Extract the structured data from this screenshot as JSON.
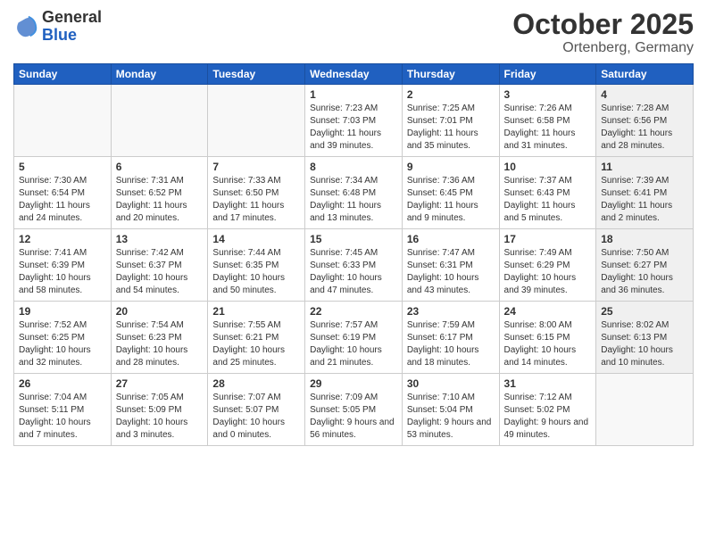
{
  "header": {
    "logo_general": "General",
    "logo_blue": "Blue",
    "month_title": "October 2025",
    "location": "Ortenberg, Germany"
  },
  "weekdays": [
    "Sunday",
    "Monday",
    "Tuesday",
    "Wednesday",
    "Thursday",
    "Friday",
    "Saturday"
  ],
  "weeks": [
    [
      {
        "day": "",
        "info": "",
        "empty": true
      },
      {
        "day": "",
        "info": "",
        "empty": true
      },
      {
        "day": "",
        "info": "",
        "empty": true
      },
      {
        "day": "1",
        "info": "Sunrise: 7:23 AM\nSunset: 7:03 PM\nDaylight: 11 hours and 39 minutes.",
        "shaded": false
      },
      {
        "day": "2",
        "info": "Sunrise: 7:25 AM\nSunset: 7:01 PM\nDaylight: 11 hours and 35 minutes.",
        "shaded": false
      },
      {
        "day": "3",
        "info": "Sunrise: 7:26 AM\nSunset: 6:58 PM\nDaylight: 11 hours and 31 minutes.",
        "shaded": false
      },
      {
        "day": "4",
        "info": "Sunrise: 7:28 AM\nSunset: 6:56 PM\nDaylight: 11 hours and 28 minutes.",
        "shaded": true
      }
    ],
    [
      {
        "day": "5",
        "info": "Sunrise: 7:30 AM\nSunset: 6:54 PM\nDaylight: 11 hours and 24 minutes.",
        "shaded": false
      },
      {
        "day": "6",
        "info": "Sunrise: 7:31 AM\nSunset: 6:52 PM\nDaylight: 11 hours and 20 minutes.",
        "shaded": false
      },
      {
        "day": "7",
        "info": "Sunrise: 7:33 AM\nSunset: 6:50 PM\nDaylight: 11 hours and 17 minutes.",
        "shaded": false
      },
      {
        "day": "8",
        "info": "Sunrise: 7:34 AM\nSunset: 6:48 PM\nDaylight: 11 hours and 13 minutes.",
        "shaded": false
      },
      {
        "day": "9",
        "info": "Sunrise: 7:36 AM\nSunset: 6:45 PM\nDaylight: 11 hours and 9 minutes.",
        "shaded": false
      },
      {
        "day": "10",
        "info": "Sunrise: 7:37 AM\nSunset: 6:43 PM\nDaylight: 11 hours and 5 minutes.",
        "shaded": false
      },
      {
        "day": "11",
        "info": "Sunrise: 7:39 AM\nSunset: 6:41 PM\nDaylight: 11 hours and 2 minutes.",
        "shaded": true
      }
    ],
    [
      {
        "day": "12",
        "info": "Sunrise: 7:41 AM\nSunset: 6:39 PM\nDaylight: 10 hours and 58 minutes.",
        "shaded": false
      },
      {
        "day": "13",
        "info": "Sunrise: 7:42 AM\nSunset: 6:37 PM\nDaylight: 10 hours and 54 minutes.",
        "shaded": false
      },
      {
        "day": "14",
        "info": "Sunrise: 7:44 AM\nSunset: 6:35 PM\nDaylight: 10 hours and 50 minutes.",
        "shaded": false
      },
      {
        "day": "15",
        "info": "Sunrise: 7:45 AM\nSunset: 6:33 PM\nDaylight: 10 hours and 47 minutes.",
        "shaded": false
      },
      {
        "day": "16",
        "info": "Sunrise: 7:47 AM\nSunset: 6:31 PM\nDaylight: 10 hours and 43 minutes.",
        "shaded": false
      },
      {
        "day": "17",
        "info": "Sunrise: 7:49 AM\nSunset: 6:29 PM\nDaylight: 10 hours and 39 minutes.",
        "shaded": false
      },
      {
        "day": "18",
        "info": "Sunrise: 7:50 AM\nSunset: 6:27 PM\nDaylight: 10 hours and 36 minutes.",
        "shaded": true
      }
    ],
    [
      {
        "day": "19",
        "info": "Sunrise: 7:52 AM\nSunset: 6:25 PM\nDaylight: 10 hours and 32 minutes.",
        "shaded": false
      },
      {
        "day": "20",
        "info": "Sunrise: 7:54 AM\nSunset: 6:23 PM\nDaylight: 10 hours and 28 minutes.",
        "shaded": false
      },
      {
        "day": "21",
        "info": "Sunrise: 7:55 AM\nSunset: 6:21 PM\nDaylight: 10 hours and 25 minutes.",
        "shaded": false
      },
      {
        "day": "22",
        "info": "Sunrise: 7:57 AM\nSunset: 6:19 PM\nDaylight: 10 hours and 21 minutes.",
        "shaded": false
      },
      {
        "day": "23",
        "info": "Sunrise: 7:59 AM\nSunset: 6:17 PM\nDaylight: 10 hours and 18 minutes.",
        "shaded": false
      },
      {
        "day": "24",
        "info": "Sunrise: 8:00 AM\nSunset: 6:15 PM\nDaylight: 10 hours and 14 minutes.",
        "shaded": false
      },
      {
        "day": "25",
        "info": "Sunrise: 8:02 AM\nSunset: 6:13 PM\nDaylight: 10 hours and 10 minutes.",
        "shaded": true
      }
    ],
    [
      {
        "day": "26",
        "info": "Sunrise: 7:04 AM\nSunset: 5:11 PM\nDaylight: 10 hours and 7 minutes.",
        "shaded": false
      },
      {
        "day": "27",
        "info": "Sunrise: 7:05 AM\nSunset: 5:09 PM\nDaylight: 10 hours and 3 minutes.",
        "shaded": false
      },
      {
        "day": "28",
        "info": "Sunrise: 7:07 AM\nSunset: 5:07 PM\nDaylight: 10 hours and 0 minutes.",
        "shaded": false
      },
      {
        "day": "29",
        "info": "Sunrise: 7:09 AM\nSunset: 5:05 PM\nDaylight: 9 hours and 56 minutes.",
        "shaded": false
      },
      {
        "day": "30",
        "info": "Sunrise: 7:10 AM\nSunset: 5:04 PM\nDaylight: 9 hours and 53 minutes.",
        "shaded": false
      },
      {
        "day": "31",
        "info": "Sunrise: 7:12 AM\nSunset: 5:02 PM\nDaylight: 9 hours and 49 minutes.",
        "shaded": false
      },
      {
        "day": "",
        "info": "",
        "empty": true
      }
    ]
  ]
}
